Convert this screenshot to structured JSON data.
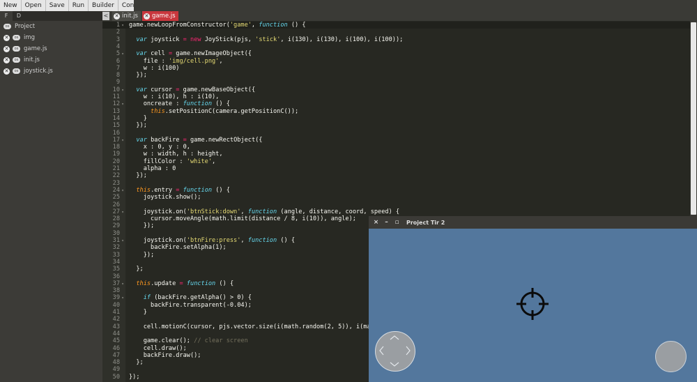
{
  "menu": [
    "New",
    "Open",
    "Save",
    "Run",
    "Builder",
    "Config"
  ],
  "sidebar": {
    "tabs": [
      "F",
      "D"
    ],
    "root": "Project",
    "os_badge": "os",
    "items": [
      "img",
      "game.js",
      "init.js",
      "joystick.js"
    ]
  },
  "tabs": {
    "collapse": "<",
    "files": [
      {
        "label": "init.js",
        "active": false
      },
      {
        "label": "game.js",
        "active": true
      }
    ]
  },
  "code": [
    "game.newLoopFromConstructor('game', function () {",
    "",
    "  var joystick = new JoyStick(pjs, 'stick', i(130), i(130), i(100), i(100));",
    "",
    "  var cell = game.newImageObject({",
    "    file : 'img/cell.png',",
    "    w : i(100)",
    "  });",
    "",
    "  var cursor = game.newBaseObject({",
    "    w : i(10), h : i(10),",
    "    oncreate : function () {",
    "      this.setPositionC(camera.getPositionC());",
    "    }",
    "  });",
    "",
    "  var backFire = game.newRectObject({",
    "    x : 0, y : 0,",
    "    w : width, h : height,",
    "    fillColor : 'white',",
    "    alpha : 0",
    "  });",
    "",
    "  this.entry = function () {",
    "    joystick.show();",
    "",
    "    joystick.on('btnStick:down', function (angle, distance, coord, speed) {",
    "      cursor.moveAngle(math.limit(distance / 8, i(10)), angle);",
    "    });",
    "",
    "    joystick.on('btnFire:press', function () {",
    "      backFire.setAlpha(1);",
    "    });",
    "",
    "  };",
    "",
    "  this.update = function () {",
    "",
    "    if (backFire.getAlpha() > 0) {",
    "      backFire.transparent(-0.04);",
    "    }",
    "",
    "    cell.motionC(cursor, pjs.vector.size(i(math.random(2, 5)), i(ma",
    "",
    "    game.clear(); // clear screen",
    "    cell.draw();",
    "    backFire.draw();",
    "  };",
    "",
    "});"
  ],
  "fold_lines": [
    1,
    5,
    10,
    12,
    17,
    24,
    27,
    31,
    37,
    39
  ],
  "game_window": {
    "title": "Project Tir 2",
    "close": "×",
    "minimize": "–",
    "maximize": "▫"
  },
  "colors": {
    "game_bg": "#53779d",
    "active_tab": "#c9373d",
    "editor_bg": "#272822"
  }
}
